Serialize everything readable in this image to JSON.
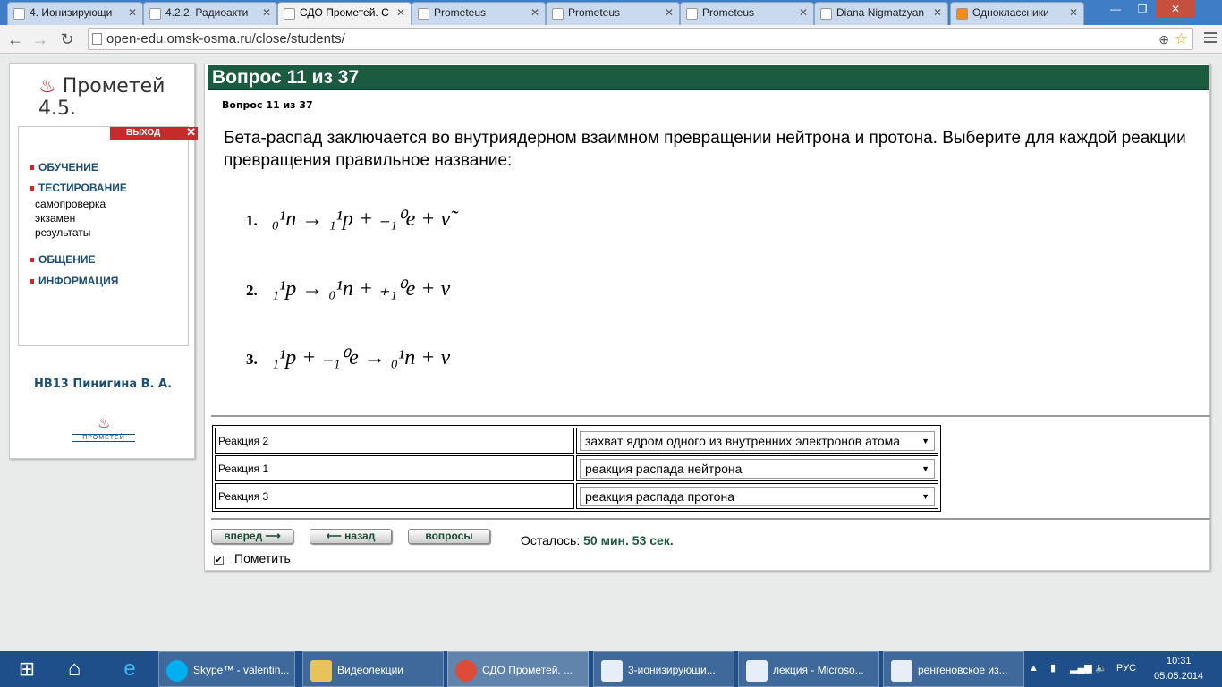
{
  "browser": {
    "tabs": [
      {
        "label": "4. Ионизирующи",
        "active": false
      },
      {
        "label": "4.2.2. Радиоакти",
        "active": false
      },
      {
        "label": "СДО Прометей. С",
        "active": true
      },
      {
        "label": "Prometeus",
        "active": false
      },
      {
        "label": "Prometeus",
        "active": false
      },
      {
        "label": "Prometeus",
        "active": false
      },
      {
        "label": "Diana Nigmatzyan",
        "active": false
      },
      {
        "label": "Одноклассники",
        "active": false
      }
    ],
    "url": "open-edu.omsk-osma.ru/close/students/"
  },
  "sidebar": {
    "logo": "Прометей 4.5.",
    "exit_label": "ВЫХОД",
    "menu": {
      "learning": "ОБУЧЕНИЕ",
      "testing": "ТЕСТИРОВАНИЕ",
      "selfcheck": "самопроверка",
      "exam": "экзамен",
      "results": "результаты",
      "communication": "ОБЩЕНИЕ",
      "information": "ИНФОРМАЦИЯ"
    },
    "user": "НВ13 Пинигина В. А.",
    "footer_logo": "ПРОМЕТЕЙ"
  },
  "question": {
    "header": "Вопрос 11 из 37",
    "subheader": "Вопрос 11 из 37",
    "text": "Бета-распад заключается во внутриядерном взаимном превращении нейтрона и протона. Выберите для каждой реакции превращения правильное название:",
    "equations": [
      {
        "num": "1.",
        "formula": "₀¹n → ₁¹p + ₋₁⁰e + ν̃"
      },
      {
        "num": "2.",
        "formula": "₁¹p → ₀¹n + ₊₁⁰e + ν"
      },
      {
        "num": "3.",
        "formula": "₁¹p + ₋₁⁰e → ₀¹n + ν"
      }
    ]
  },
  "answers": [
    {
      "label": "Реакция 2",
      "selected": "захват ядром одного из внутренних электронов атома"
    },
    {
      "label": "Реакция 1",
      "selected": "реакция распада нейтрона"
    },
    {
      "label": "Реакция 3",
      "selected": "реакция распада протона"
    }
  ],
  "controls": {
    "forward": "вперед ⟶",
    "back": "⟵ назад",
    "questions": "вопросы",
    "remaining_label": "Осталось:",
    "remaining_value": "50 мин. 53 сек.",
    "mark_label": "Пометить",
    "mark_checked": true
  },
  "taskbar": {
    "items": [
      {
        "label": "Skype™ - valentin..."
      },
      {
        "label": "Видеолекции"
      },
      {
        "label": "СДО Прометей. ..."
      },
      {
        "label": "3-ионизирующи..."
      },
      {
        "label": "лекция - Microso..."
      },
      {
        "label": "ренгеновское из..."
      }
    ],
    "lang": "РУС",
    "time": "10:31",
    "date": "05.05.2014"
  },
  "colors": {
    "header_green": "#1b5b40",
    "tabbar_blue": "#3f7ec6",
    "taskbar_blue": "#1e4f8a",
    "accent_red": "#c62b2b"
  }
}
